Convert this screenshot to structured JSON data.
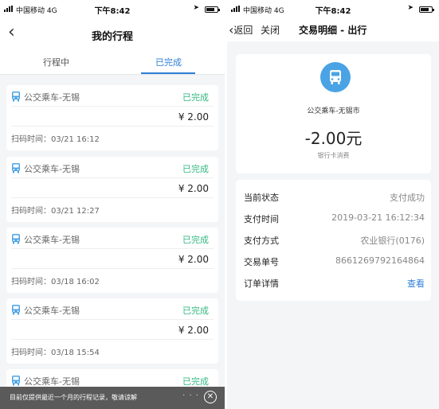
{
  "left": {
    "status": {
      "carrier": "中国移动  4G",
      "time": "下午8:42"
    },
    "nav": {
      "title": "我的行程"
    },
    "tabs": [
      {
        "label": "行程中"
      },
      {
        "label": "已完成"
      }
    ],
    "trips": [
      {
        "route": "公交乘车-无锡",
        "status": "已完成",
        "amount": "¥ 2.00",
        "scan_time": "扫码时间：03/21 16:12"
      },
      {
        "route": "公交乘车-无锡",
        "status": "已完成",
        "amount": "¥ 2.00",
        "scan_time": "扫码时间：03/21 12:27"
      },
      {
        "route": "公交乘车-无锡",
        "status": "已完成",
        "amount": "¥ 2.00",
        "scan_time": "扫码时间：03/18 16:02"
      },
      {
        "route": "公交乘车-无锡",
        "status": "已完成",
        "amount": "¥ 2.00",
        "scan_time": "扫码时间：03/18 15:54"
      },
      {
        "route": "公交乘车-无锡",
        "status": "已完成"
      }
    ],
    "toast": "目前仅提供最近一个月的行程记录，敬请谅解"
  },
  "right": {
    "status": {
      "carrier": "中国移动  4G",
      "time": "下午8:42"
    },
    "nav": {
      "back": "返回",
      "close": "关闭",
      "title": "交易明细 - 出行"
    },
    "summary": {
      "merchant": "公交乘车-无锡市",
      "amount": "-2.00元",
      "desc": "银行卡消费"
    },
    "details": [
      {
        "key": "当前状态",
        "value": "支付成功"
      },
      {
        "key": "支付时间",
        "value": "2019-03-21 16:12:34"
      },
      {
        "key": "支付方式",
        "value": "农业银行(0176)"
      },
      {
        "key": "交易单号",
        "value": "8661269792164864"
      },
      {
        "key": "订单详情",
        "value": "查看"
      }
    ]
  },
  "colors": {
    "accent": "#2e7ed6",
    "success": "#35b882",
    "bus_icon": "#4aa3e4"
  },
  "icons": [
    "back-chevron-icon",
    "bus-icon",
    "close-circle-icon",
    "location-arrow-icon",
    "battery-icon",
    "signal-icon"
  ]
}
